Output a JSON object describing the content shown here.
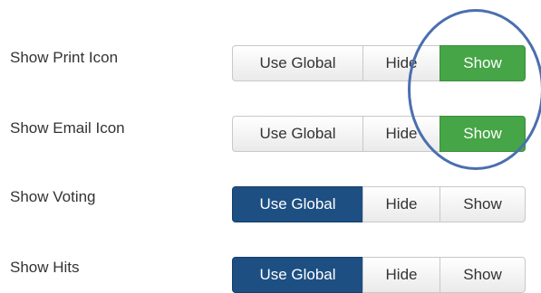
{
  "settings": [
    {
      "label": "Show Print Icon",
      "options": {
        "global": "Use Global",
        "hide": "Hide",
        "show": "Show"
      },
      "selected": "show"
    },
    {
      "label": "Show Email Icon",
      "options": {
        "global": "Use Global",
        "hide": "Hide",
        "show": "Show"
      },
      "selected": "show"
    },
    {
      "label": "Show Voting",
      "options": {
        "global": "Use Global",
        "hide": "Hide",
        "show": "Show"
      },
      "selected": "global"
    },
    {
      "label": "Show Hits",
      "options": {
        "global": "Use Global",
        "hide": "Hide",
        "show": "Show"
      },
      "selected": "global"
    }
  ],
  "colors": {
    "show_active": "#46a546",
    "global_active": "#1d4f82",
    "annotation_circle": "#4a6fae"
  }
}
